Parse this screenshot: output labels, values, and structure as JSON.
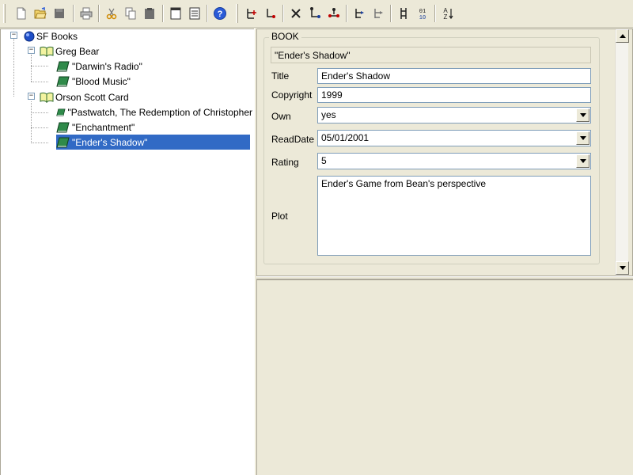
{
  "toolbar": {
    "buttons": [
      {
        "icon": "new-document-icon"
      },
      {
        "icon": "open-folder-icon"
      },
      {
        "icon": "save-icon"
      },
      {
        "icon": "print-icon"
      },
      {
        "icon": "cut-icon"
      },
      {
        "icon": "copy-icon"
      },
      {
        "icon": "paste-icon"
      },
      {
        "icon": "window-icon"
      },
      {
        "icon": "properties-icon"
      },
      {
        "icon": "help-icon"
      },
      {
        "icon": "add-child-node-icon"
      },
      {
        "icon": "add-sibling-node-icon"
      },
      {
        "icon": "delete-node-icon"
      },
      {
        "icon": "move-node-down-icon"
      },
      {
        "icon": "move-node-right-icon"
      },
      {
        "icon": "insert-node-icon"
      },
      {
        "icon": "duplicate-node-icon"
      },
      {
        "icon": "tree-view-icon"
      },
      {
        "icon": "binary-view-icon"
      },
      {
        "icon": "sort-az-icon"
      }
    ],
    "binary_label_top": "01",
    "binary_label_bottom": "10",
    "sort_label_top": "A",
    "sort_label_bottom": "Z"
  },
  "tree": {
    "root": "SF Books",
    "authors": [
      {
        "name": "Greg Bear",
        "books": [
          "\"Darwin's Radio\"",
          "\"Blood Music\""
        ]
      },
      {
        "name": "Orson Scott Card",
        "books": [
          "\"Pastwatch, The Redemption of Christopher",
          "\"Enchantment\"",
          "\"Ender's Shadow\""
        ]
      }
    ],
    "expander_collapse": "−"
  },
  "form": {
    "group_title": "BOOK",
    "display_title": "\"Ender's Shadow\"",
    "fields": {
      "title": {
        "label": "Title",
        "value": "Ender's Shadow"
      },
      "copyright": {
        "label": "Copyright",
        "value": "1999"
      },
      "own": {
        "label": "Own",
        "value": "yes"
      },
      "readdate": {
        "label": "ReadDate",
        "value": "05/01/2001"
      },
      "rating": {
        "label": "Rating",
        "value": "5"
      },
      "plot": {
        "label": "Plot",
        "value": "Ender's Game from Bean's perspective"
      }
    }
  },
  "colors": {
    "selection": "#316ac5",
    "toolbar_bg": "#ece9d8",
    "help_blue": "#2a5bd7",
    "node_red": "#c00000"
  }
}
